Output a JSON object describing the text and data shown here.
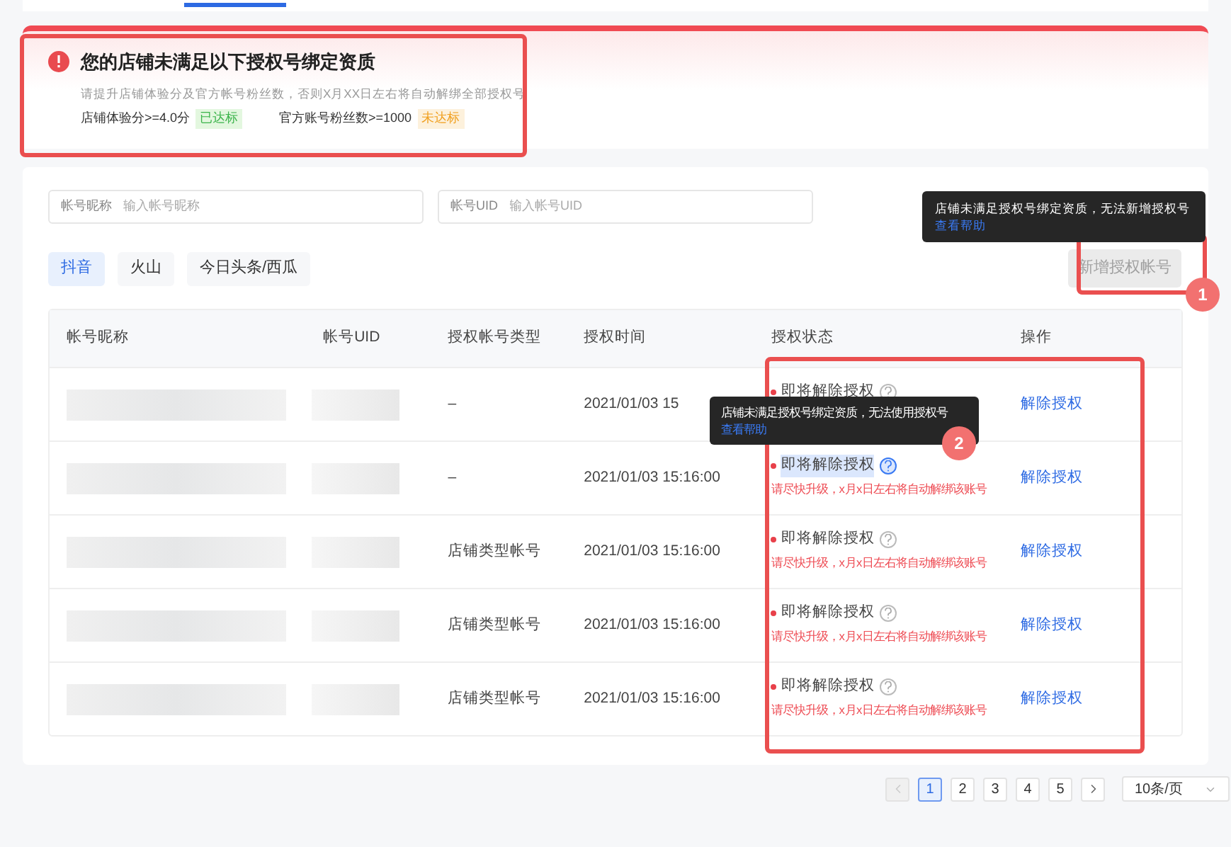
{
  "alert": {
    "title": "您的店铺未满足以下授权号绑定资质",
    "description": "请提升店铺体验分及官方帐号粉丝数，否则X月XX日左右将自动解绑全部授权号",
    "criteria": [
      {
        "label": "店铺体验分>=4.0分",
        "status": "已达标",
        "met": true
      },
      {
        "label": "官方账号粉丝数>=1000",
        "status": "未达标",
        "met": false
      }
    ]
  },
  "filters": [
    {
      "label": "帐号昵称",
      "placeholder": "输入帐号昵称"
    },
    {
      "label": "帐号UID",
      "placeholder": "输入帐号UID"
    }
  ],
  "platform_tabs": [
    {
      "label": "抖音",
      "selected": true
    },
    {
      "label": "火山",
      "selected": false
    },
    {
      "label": "今日头条/西瓜",
      "selected": false
    }
  ],
  "add_button": {
    "label": "新增授权帐号",
    "disabled": true
  },
  "add_tooltip": {
    "text": "店铺未满足授权号绑定资质，无法新增授权号",
    "link": "查看帮助"
  },
  "table": {
    "columns": [
      "帐号昵称",
      "帐号UID",
      "授权帐号类型",
      "授权时间",
      "授权状态",
      "操作"
    ],
    "rows": [
      {
        "type": "–",
        "time": "2021/01/03 15",
        "status": "即将解除授权",
        "help_active": false,
        "action": "解除授权"
      },
      {
        "type": "–",
        "time": "2021/01/03 15:16:00",
        "status": "即将解除授权",
        "help_active": true,
        "hint": "请尽快升级，x月x日左右将自动解绑该账号",
        "action": "解除授权"
      },
      {
        "type": "店铺类型帐号",
        "time": "2021/01/03 15:16:00",
        "status": "即将解除授权",
        "help_active": false,
        "hint": "请尽快升级，x月x日左右将自动解绑该账号",
        "action": "解除授权"
      },
      {
        "type": "店铺类型帐号",
        "time": "2021/01/03 15:16:00",
        "status": "即将解除授权",
        "help_active": false,
        "hint": "请尽快升级，x月x日左右将自动解绑该账号",
        "action": "解除授权"
      },
      {
        "type": "店铺类型帐号",
        "time": "2021/01/03 15:16:00",
        "status": "即将解除授权",
        "help_active": false,
        "hint": "请尽快升级，x月x日左右将自动解绑该账号",
        "action": "解除授权"
      }
    ]
  },
  "status_tooltip": {
    "text": "店铺未满足授权号绑定资质，无法使用授权号",
    "link": "查看帮助"
  },
  "annotations": [
    {
      "label": "1"
    },
    {
      "label": "2"
    }
  ],
  "pagination": {
    "prev_disabled": true,
    "pages": [
      {
        "label": "1",
        "selected": true
      },
      {
        "label": "2",
        "selected": false
      },
      {
        "label": "3",
        "selected": false
      },
      {
        "label": "4",
        "selected": false
      },
      {
        "label": "5",
        "selected": false
      }
    ],
    "page_size": "10条/页"
  }
}
